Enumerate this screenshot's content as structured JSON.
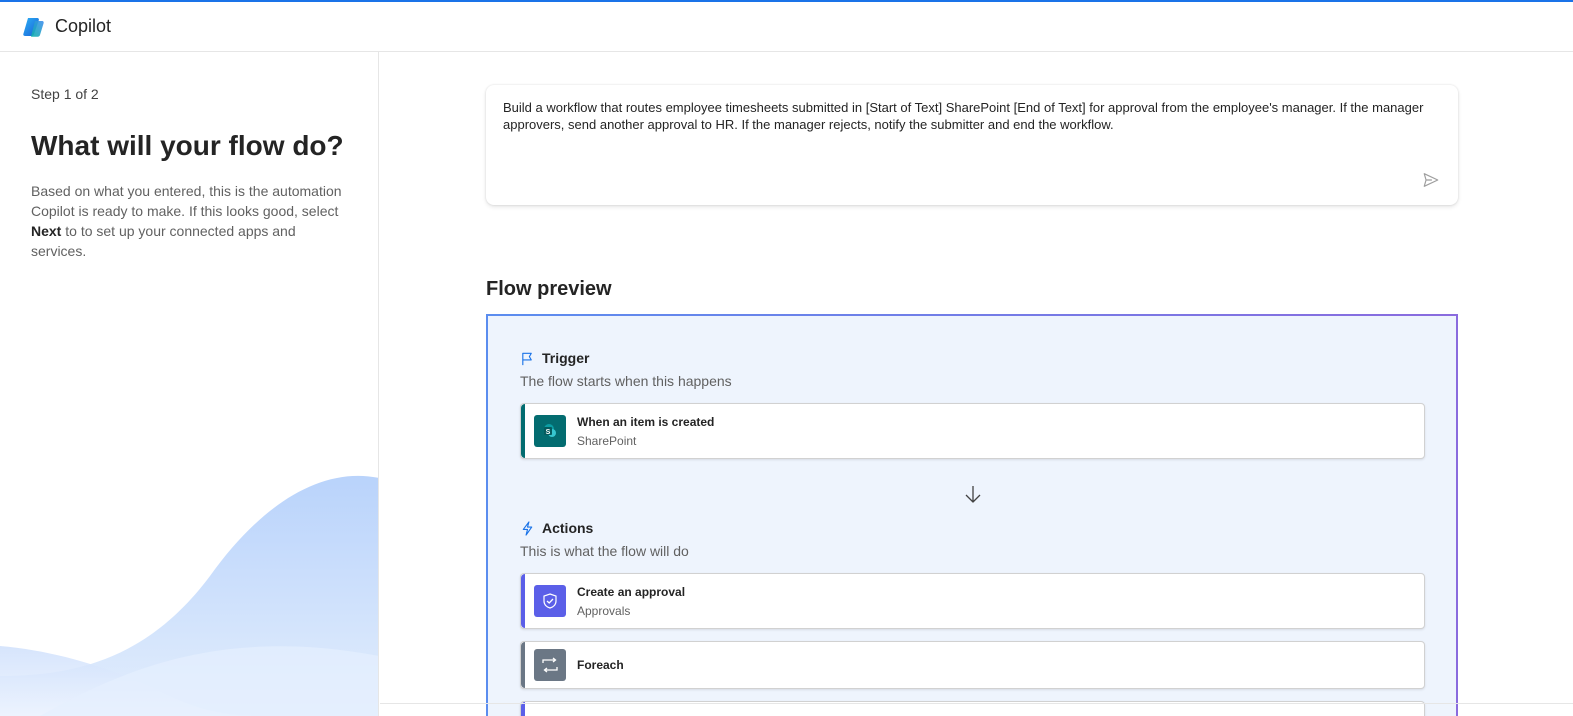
{
  "app": {
    "title": "Copilot"
  },
  "sidebar": {
    "step_label": "Step 1 of 2",
    "title": "What will your flow do?",
    "description_before": "Based on what you entered, this is the automation Copilot is ready to make. If this looks good, select ",
    "description_bold": "Next",
    "description_after": " to to set up your connected apps and services."
  },
  "prompt": {
    "text": "Build a workflow that routes employee timesheets submitted in [Start of Text] SharePoint [End of Text] for approval from the employee's manager. If the manager approvers, send another approval to HR. If the manager rejects, notify the submitter and end the workflow.",
    "send_icon": "send-icon"
  },
  "preview": {
    "title": "Flow preview",
    "trigger": {
      "title": "Trigger",
      "subtitle": "The flow starts when this happens",
      "icon": "flag-icon",
      "card": {
        "name": "When an item is created",
        "connector": "SharePoint",
        "color": "#036c70",
        "icon": "sharepoint-icon"
      }
    },
    "arrow_icon": "arrow-down-icon",
    "actions": {
      "title": "Actions",
      "subtitle": "This is what the flow will do",
      "icon": "lightning-icon",
      "cards": [
        {
          "name": "Create an approval",
          "connector": "Approvals",
          "color": "#5b5fe8",
          "icon": "approval-icon"
        },
        {
          "name": "Foreach",
          "connector": "",
          "color": "#6b7785",
          "icon": "loop-icon"
        }
      ]
    }
  },
  "colors": {
    "accent": "#1a73e8",
    "panel_bg": "#eef4fd",
    "sharepoint": "#036c70",
    "approvals": "#5b5fe8",
    "control": "#6b7785"
  }
}
